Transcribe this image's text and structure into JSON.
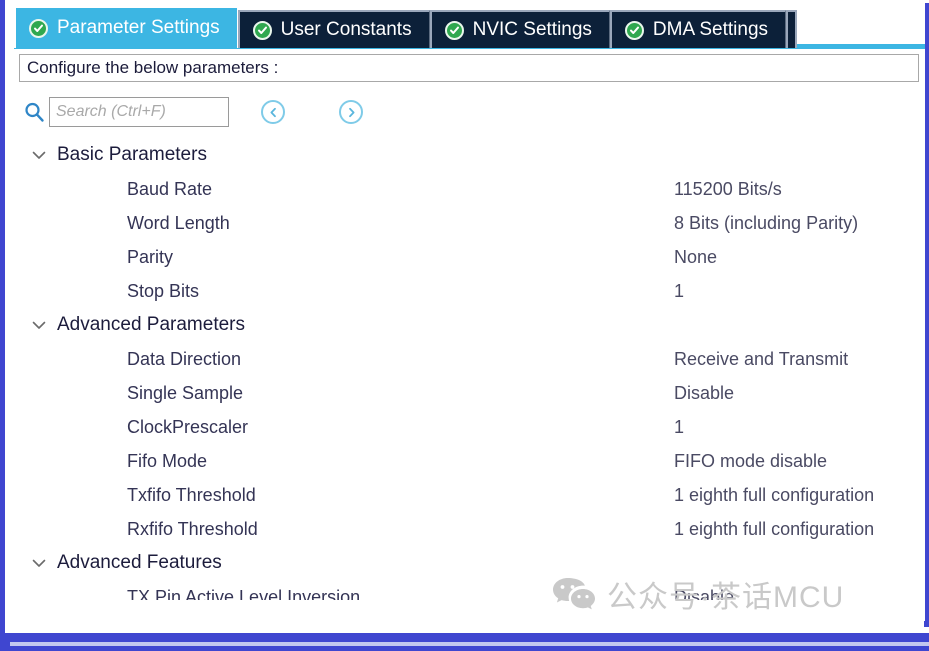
{
  "colors": {
    "frame": "#3f46d0",
    "active_tab_bg": "#3cb6e3",
    "inactive_tab_bg": "#0c2039",
    "check_green": "#2fa84f",
    "nav_blue": "#7fcbe8",
    "watermark_gray": "#c9c9c9"
  },
  "tabs": [
    {
      "label": "Parameter Settings",
      "icon": "check-circle-icon",
      "active": true
    },
    {
      "label": "User Constants",
      "icon": "check-circle-icon",
      "active": false
    },
    {
      "label": "NVIC Settings",
      "icon": "check-circle-icon",
      "active": false
    },
    {
      "label": "DMA Settings",
      "icon": "check-circle-icon",
      "active": false
    }
  ],
  "configure_bar": {
    "label": "Configure the below parameters :"
  },
  "search": {
    "icon": "search-icon",
    "placeholder": "Search (Ctrl+F)",
    "value": "",
    "prev_label": "‹",
    "next_label": "›"
  },
  "tree": {
    "groups": [
      {
        "label": "Basic Parameters",
        "expanded": true,
        "rows": [
          {
            "name": "Baud Rate",
            "value": "115200 Bits/s"
          },
          {
            "name": "Word Length",
            "value": "8 Bits (including Parity)"
          },
          {
            "name": "Parity",
            "value": "None"
          },
          {
            "name": "Stop Bits",
            "value": "1"
          }
        ]
      },
      {
        "label": "Advanced Parameters",
        "expanded": true,
        "rows": [
          {
            "name": "Data Direction",
            "value": "Receive and Transmit"
          },
          {
            "name": "Single Sample",
            "value": "Disable"
          },
          {
            "name": "ClockPrescaler",
            "value": "1"
          },
          {
            "name": "Fifo Mode",
            "value": "FIFO mode disable"
          },
          {
            "name": "Txfifo Threshold",
            "value": "1 eighth full configuration"
          },
          {
            "name": "Rxfifo Threshold",
            "value": "1 eighth full configuration"
          }
        ]
      },
      {
        "label": "Advanced Features",
        "expanded": true,
        "rows": [
          {
            "name": "TX Pin Active Level Inversion",
            "value": "Disable"
          }
        ]
      }
    ]
  },
  "watermark": {
    "icon": "wechat-icon",
    "text": "公众号·茶话MCU"
  }
}
